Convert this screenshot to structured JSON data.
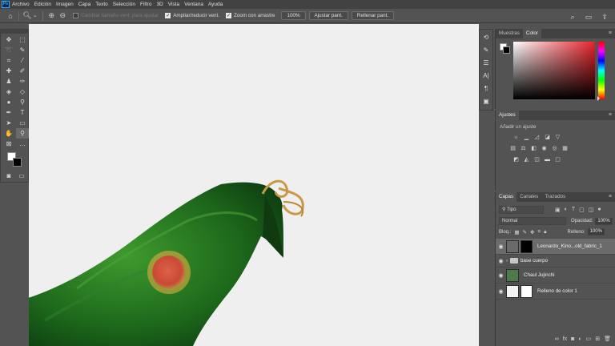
{
  "app": {
    "logo": "Ps"
  },
  "menu": [
    "Archivo",
    "Edición",
    "Imagen",
    "Capa",
    "Texto",
    "Selección",
    "Filtro",
    "3D",
    "Vista",
    "Ventana",
    "Ayuda"
  ],
  "options": {
    "resize_windows": "Cambiar tamaño vent. para ajustar",
    "zoom_all": "Ampliar/reducir vent.",
    "scrubby_zoom": "Zoom con arrastre",
    "zoom_value": "100%",
    "fit_screen": "Ajustar pant.",
    "fill_screen": "Rellenar pant."
  },
  "swatches_tab": "Muestras",
  "color_tab": "Color",
  "adjustments": {
    "tab": "Ajustes",
    "subtitle": "Añadir un ajuste"
  },
  "layers": {
    "tabs": [
      "Capas",
      "Canales",
      "Trazados"
    ],
    "kind_filter": "Tipo",
    "blend_mode": "Normal",
    "opacity_label": "Opacidad:",
    "opacity_value": "100%",
    "lock_label": "Bloq.:",
    "fill_label": "Relleno:",
    "fill_value": "100%",
    "items": [
      {
        "name": "Leonardo_Kino...old_fabric_1",
        "selected": true
      },
      {
        "name": "base cuerpo",
        "type": "group"
      },
      {
        "name": "Chaul Jujinchi"
      },
      {
        "name": "Relleno de color 1"
      }
    ]
  },
  "colors": {
    "accent": "#31a8ff",
    "canvas": "#efefef",
    "panel": "#535353"
  }
}
